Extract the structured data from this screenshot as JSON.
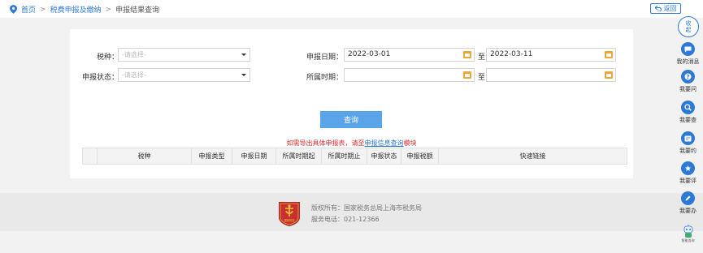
{
  "breadcrumb": {
    "home": "首页",
    "section": "税费申报及缴纳",
    "current": "申报结果查询"
  },
  "back_button": "返回",
  "form": {
    "tax_type_label": "税种：",
    "tax_type_placeholder": "-请选择-",
    "status_label": "申报状态：",
    "status_placeholder": "-请选择-",
    "declare_date_label": "申报日期：",
    "declare_date_from": "2022-03-01",
    "declare_date_to": "2022-03-11",
    "period_label": "所属时期：",
    "period_from": "",
    "period_to": "",
    "to_label": "至"
  },
  "query_button": "查询",
  "note": {
    "prefix": "如需导出具体申报表，请至",
    "link": "申报信息查询",
    "suffix": "模块"
  },
  "table": {
    "columns": [
      "",
      "税种",
      "申报类型",
      "申报日期",
      "所属时期起",
      "所属时期止",
      "申报状态",
      "申报税额",
      "快速链接"
    ]
  },
  "footer": {
    "copyright": "版权所有：国家税务总局上海市税务局",
    "phone": "服务电话：021-12366",
    "emblem_text": "国家税务"
  },
  "rail": {
    "collapse": [
      "收",
      "起"
    ],
    "items": [
      "我的消息",
      "我要问",
      "我要查",
      "我要约",
      "我要评",
      "我要办"
    ],
    "robot_label": "智能咨询"
  },
  "colors": {
    "accent": "#2d7ad6",
    "query_button": "#5aa4ea",
    "note": "#e32c2c",
    "calendar_icon": "#f0a637"
  }
}
